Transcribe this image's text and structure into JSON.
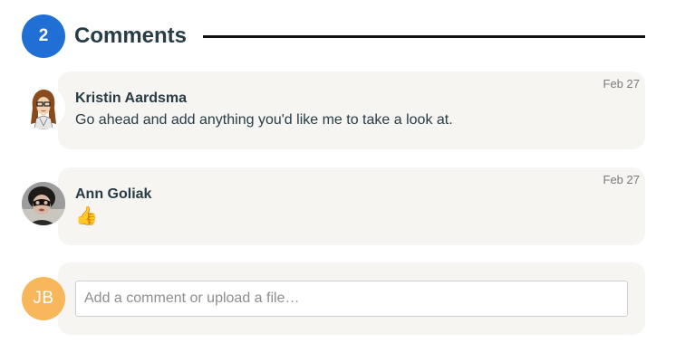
{
  "header": {
    "count": "2",
    "title": "Comments"
  },
  "comments": [
    {
      "author": "Kristin Aardsma",
      "date": "Feb 27",
      "text": "Go ahead and add anything you'd like me to take a look at."
    },
    {
      "author": "Ann Goliak",
      "date": "Feb 27",
      "text": "👍"
    }
  ],
  "composer": {
    "initials": "JB",
    "avatar_color": "#f8b75c",
    "placeholder": "Add a comment or upload a file…",
    "value": ""
  },
  "colors": {
    "badge": "#1f6fd4",
    "bubble": "#f6f5f2",
    "text": "#283c46"
  }
}
